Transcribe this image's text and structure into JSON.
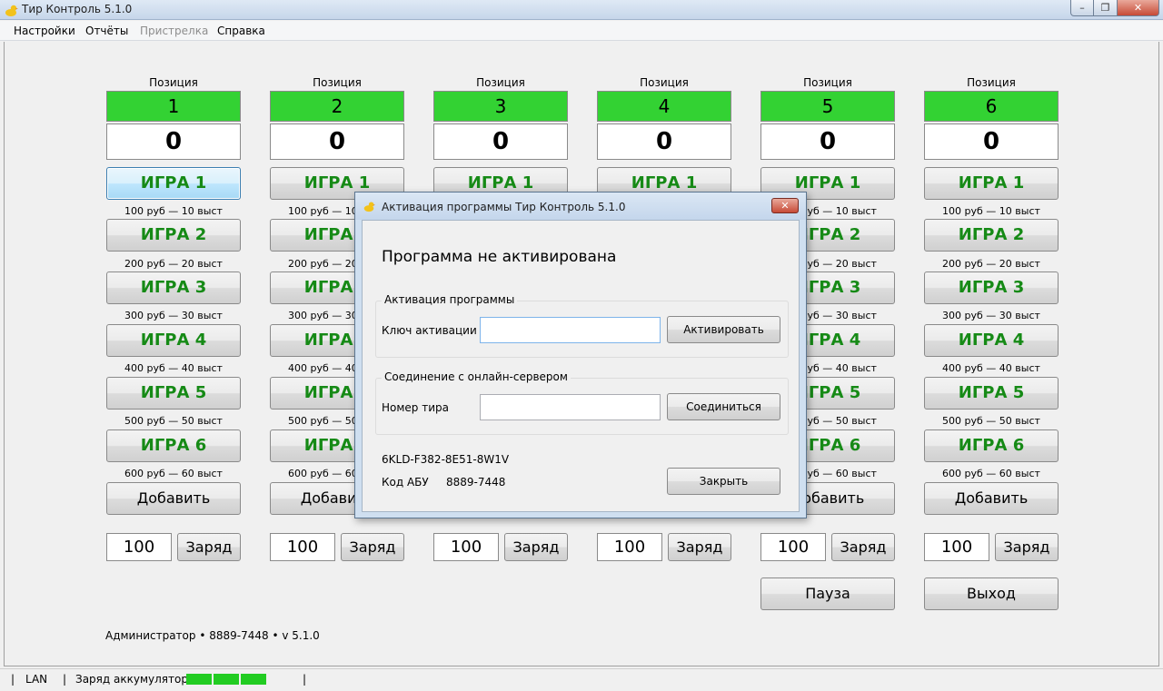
{
  "window": {
    "title": "Тир Контроль 5.1.0"
  },
  "menu": [
    "Настройки",
    "Отчёты",
    "Пристрелка",
    "Справка"
  ],
  "position_label": "Позиция",
  "positions": [
    {
      "number": "1",
      "score": "0",
      "charge": "100"
    },
    {
      "number": "2",
      "score": "0",
      "charge": "100"
    },
    {
      "number": "3",
      "score": "0",
      "charge": "100"
    },
    {
      "number": "4",
      "score": "0",
      "charge": "100"
    },
    {
      "number": "5",
      "score": "0",
      "charge": "100"
    },
    {
      "number": "6",
      "score": "0",
      "charge": "100"
    }
  ],
  "games": [
    {
      "label": "ИГРА 1",
      "price": "100 руб — 10 выст"
    },
    {
      "label": "ИГРА 2",
      "price": "200 руб — 20 выст"
    },
    {
      "label": "ИГРА 3",
      "price": "300 руб — 30 выст"
    },
    {
      "label": "ИГРА 4",
      "price": "400 руб — 40 выст"
    },
    {
      "label": "ИГРА 5",
      "price": "500 руб — 50 выст"
    },
    {
      "label": "ИГРА 6",
      "price": "600 руб — 60 выст"
    }
  ],
  "add_label": "Добавить",
  "charge_label": "Заряд",
  "pause_label": "Пауза",
  "exit_label": "Выход",
  "footer_info": "Администратор • 8889-7448 • v 5.1.0",
  "statusbar": {
    "sep": "|",
    "connection": "LAN",
    "battery_label": "Заряд аккумулятора:",
    "battery_level": 0.5
  },
  "dialog": {
    "title": "Активация программы Тир Контроль 5.1.0",
    "heading": "Программа не активирована",
    "activation_group": "Активация программы",
    "key_label": "Ключ активации",
    "key_value": "",
    "activate_button": "Активировать",
    "server_group": "Соединение с онлайн-сервером",
    "range_label": "Номер тира",
    "range_value": "",
    "connect_button": "Соединиться",
    "hardware_id": "6KLD-F382-8E51-8W1V",
    "abu_label": "Код АБУ",
    "abu_value": "8889-7448",
    "close_button": "Закрыть"
  },
  "colors": {
    "position_bg": "#33d233",
    "game_text": "#168a16",
    "battery": "#22cc22"
  }
}
